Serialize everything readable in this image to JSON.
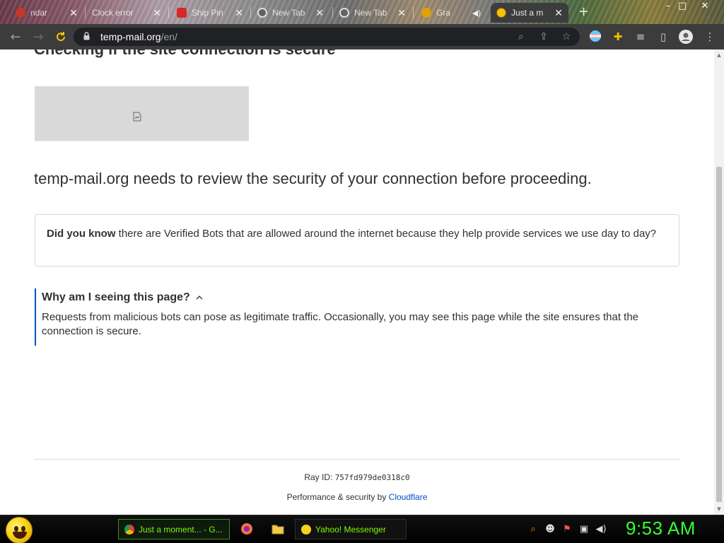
{
  "browser": {
    "tabs": [
      {
        "label": "ndar",
        "color": "#c0392b"
      },
      {
        "label": "Clock error",
        "color": "#888888"
      },
      {
        "label": "Ship Pin",
        "color": "#d62828"
      },
      {
        "label": "New Tab",
        "color": "#5f6368"
      },
      {
        "label": "New Tab",
        "color": "#5f6368"
      },
      {
        "label": "Gra",
        "color": "#e1a100"
      },
      {
        "label": "Just a m",
        "color": "#f4c20d",
        "active": true
      }
    ],
    "new_tab_glyph": "+",
    "window_controls": {
      "minimize": "–",
      "maximize": "□",
      "close": "✕"
    },
    "url_host": "temp-mail.org",
    "url_path": "/en/"
  },
  "page": {
    "heading": "Checking if the site connection is secure",
    "review_text": "temp-mail.org needs to review the security of your connection before proceeding.",
    "did_you_know_bold": "Did you know",
    "did_you_know_rest": " there are Verified Bots that are allowed around the internet because they help provide services we use day to day?",
    "why_title": "Why am I seeing this page?",
    "why_body": "Requests from malicious bots can pose as legitimate traffic. Occasionally, you may see this page while the site ensures that the connection is secure.",
    "ray_label": "Ray ID: ",
    "ray_id": "757fd979de0318c0",
    "perf_label": "Performance & security by ",
    "perf_link": "Cloudflare"
  },
  "taskbar": {
    "buttons": [
      {
        "label": "Just a moment... - G...",
        "active": true
      },
      {
        "label": "Yahoo! Messenger",
        "active": false
      }
    ],
    "clock": "9:53 AM"
  },
  "colors": {
    "accent": "#0051c3",
    "clock": "#33ff33",
    "taskbar_text": "#7CFC00"
  }
}
